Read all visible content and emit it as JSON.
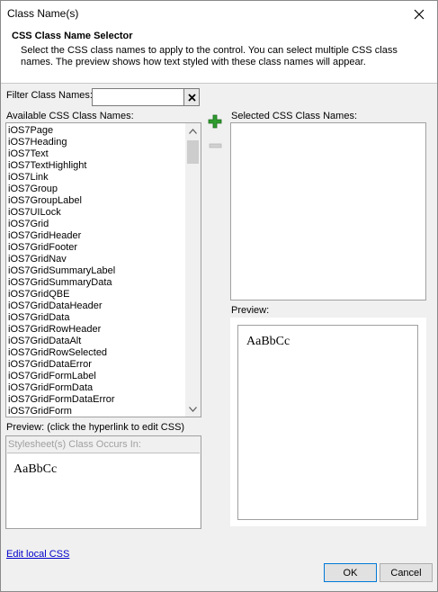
{
  "window": {
    "title": "Class Name(s)"
  },
  "header": {
    "title": "CSS Class Name Selector",
    "description": "Select the CSS class names to apply to the control. You can select multiple CSS class names. The preview shows how text styled with these class names will appear."
  },
  "filter": {
    "label": "Filter Class Names:",
    "value": ""
  },
  "available": {
    "label": "Available CSS Class Names:",
    "items": [
      "iOS7Page",
      "iOS7Heading",
      "iOS7Text",
      "iOS7TextHighlight",
      "iOS7Link",
      "iOS7Group",
      "iOS7GroupLabel",
      "iOS7UILock",
      "iOS7Grid",
      "iOS7GridHeader",
      "iOS7GridFooter",
      "iOS7GridNav",
      "iOS7GridSummaryLabel",
      "iOS7GridSummaryData",
      "iOS7GridQBE",
      "iOS7GridDataHeader",
      "iOS7GridData",
      "iOS7GridRowHeader",
      "iOS7GridDataAlt",
      "iOS7GridRowSelected",
      "iOS7GridDataError",
      "iOS7GridFormLabel",
      "iOS7GridFormData",
      "iOS7GridFormDataError",
      "iOS7GridForm"
    ]
  },
  "selected": {
    "label": "Selected CSS Class Names:"
  },
  "preview_right": {
    "label": "Preview:",
    "sample": "AaBbCc"
  },
  "preview_left": {
    "label": "Preview: (click the hyperlink to edit CSS)",
    "stylesheet_label": "Stylesheet(s) Class Occurs In:",
    "sample": "AaBbCc"
  },
  "edit_link": "Edit local CSS",
  "buttons": {
    "ok": "OK",
    "cancel": "Cancel"
  },
  "colors": {
    "add_icon": "#2e9c2e",
    "link": "#0000cc",
    "default_button_border": "#0078d7"
  },
  "icons": {
    "close": "close-icon",
    "add": "plus-icon",
    "remove": "minus-icon",
    "clear": "clear-x-icon"
  }
}
